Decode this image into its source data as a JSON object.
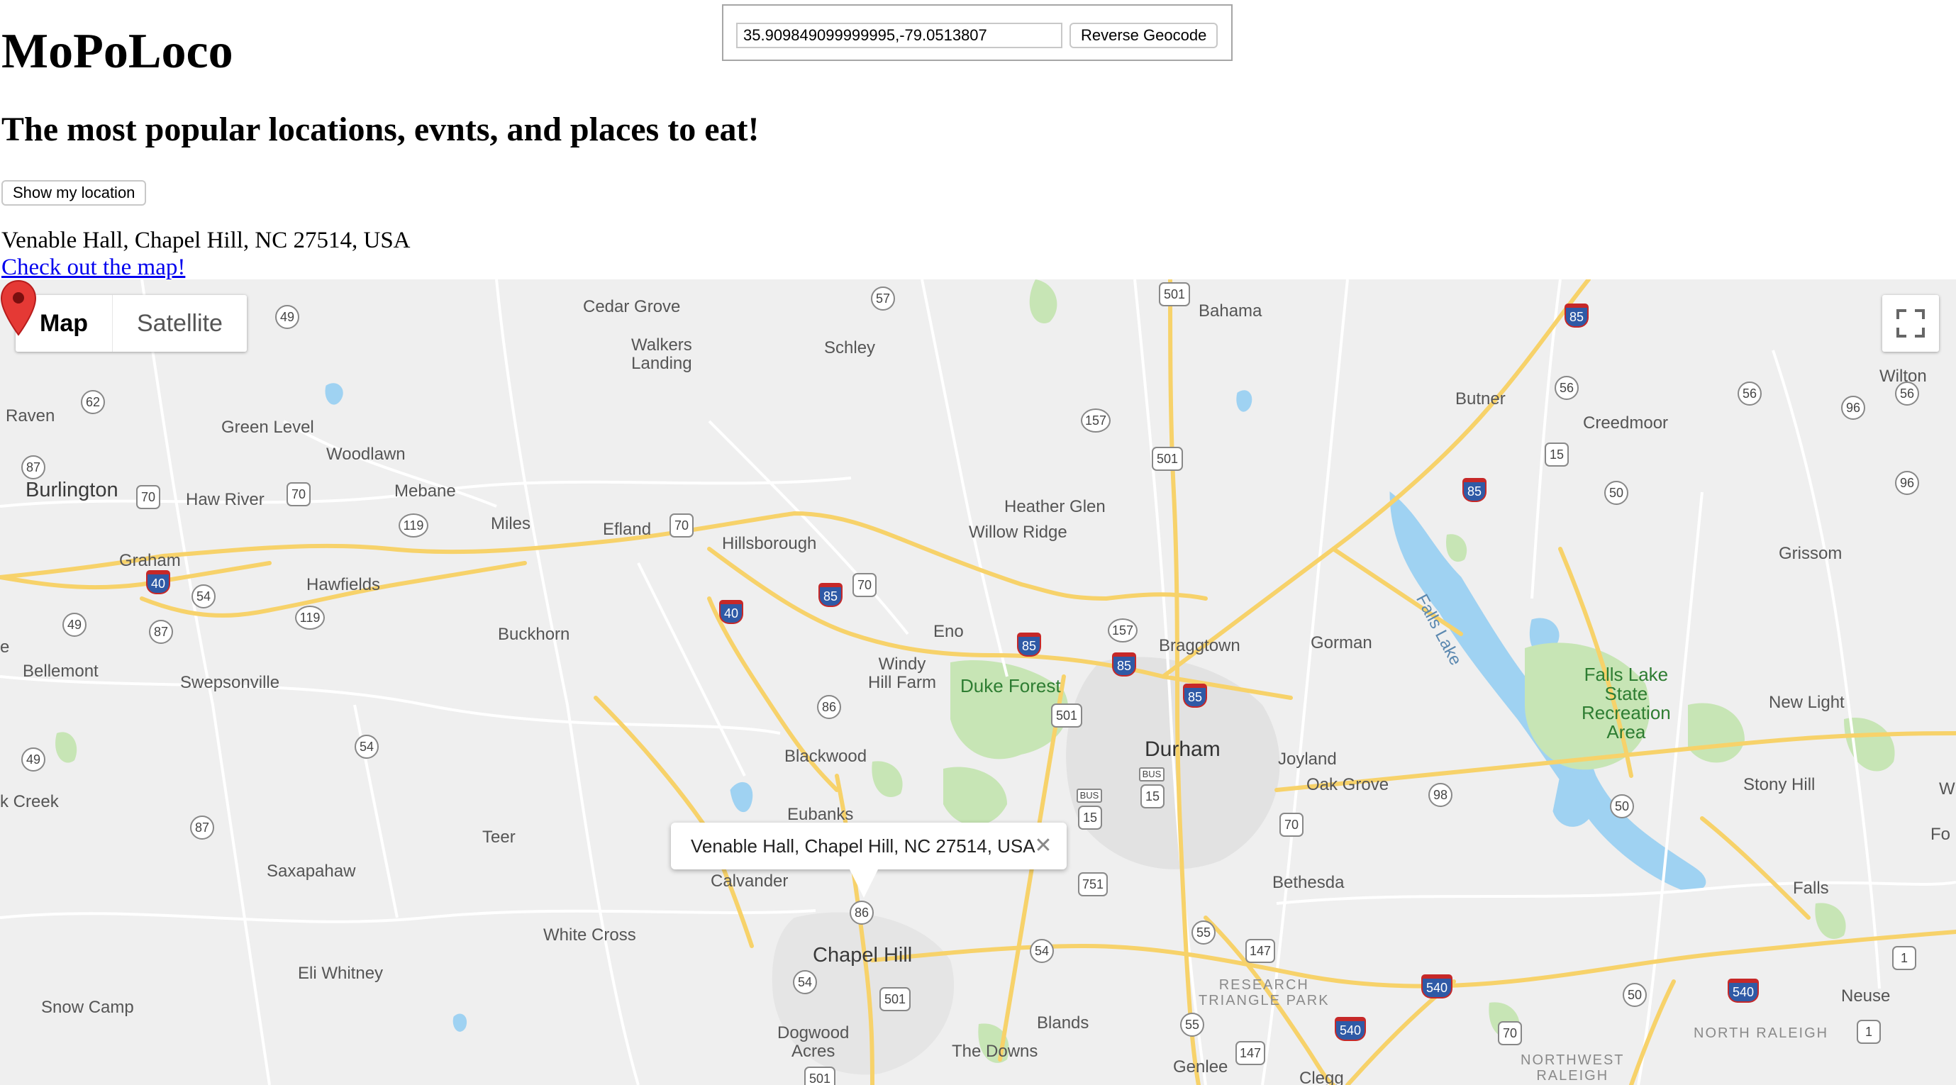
{
  "app": {
    "title": "MoPoLoco",
    "tagline": "The most popular locations, evnts, and places to eat!",
    "show_location_label": "Show my location",
    "address": "Venable Hall, Chapel Hill, NC 27514, USA",
    "map_link_label": "Check out the map!"
  },
  "geocoder": {
    "latlng_value": "35.909849099999995,-79.0513807",
    "button_label": "Reverse Geocode"
  },
  "map": {
    "type_controls": {
      "active": "Map",
      "inactive": "Satellite"
    },
    "fullscreen_icon": "fullscreen-icon",
    "marker_icon": "map-pin-icon",
    "info_window": {
      "text": "Venable Hall, Chapel Hill, NC 27514, USA",
      "close_icon": "close-icon"
    },
    "labels": {
      "cedar_grove": "Cedar Grove",
      "bahama": "Bahama",
      "walkers_landing": "Walkers\nLanding",
      "schley": "Schley",
      "wilton": "Wilton",
      "raven": "Raven",
      "green_level": "Green Level",
      "butner": "Butner",
      "creedmoor": "Creedmoor",
      "woodlawn": "Woodlawn",
      "burlington": "Burlington",
      "haw_river": "Haw River",
      "mebane": "Mebane",
      "heather_glen": "Heather Glen",
      "miles": "Miles",
      "efland": "Efland",
      "willow_ridge": "Willow Ridge",
      "hillsborough": "Hillsborough",
      "graham": "Graham",
      "grissom": "Grissom",
      "hawfields": "Hawfields",
      "falls_lake": "Falls Lake",
      "eno": "Eno",
      "buckhorn": "Buckhorn",
      "bellemont": "Bellemont",
      "windy_hill_farm": "Windy\nHill Farm",
      "braggtown": "Braggtown",
      "gorman": "Gorman",
      "falls_lake_sra": "Falls Lake\nState\nRecreation\nArea",
      "swepsonville": "Swepsonville",
      "duke_forest": "Duke Forest",
      "new_light": "New Light",
      "durham": "Durham",
      "blackwood": "Blackwood",
      "joyland": "Joyland",
      "oak_grove": "Oak Grove",
      "stony_hill": "Stony Hill",
      "k_creek": "k Creek",
      "eubanks": "Eubanks",
      "teer": "Teer",
      "saxapahaw": "Saxapahaw",
      "calvander": "Calvander",
      "bethesda": "Bethesda",
      "falls": "Falls",
      "white_cross": "White Cross",
      "chapel_hill": "Chapel Hill",
      "eli_whitney": "Eli Whitney",
      "snow_camp": "Snow Camp",
      "research_triangle_park": "RESEARCH\nTRIANGLE PARK",
      "neuse": "Neuse",
      "dogwood_acres": "Dogwood\nAcres",
      "blands": "Blands",
      "north_raleigh": "NORTH RALEIGH",
      "the_downs": "The Downs",
      "genlee": "Genlee",
      "clegg": "Clegg",
      "northwest_raleigh": "NORTHWEST\nRALEIGH",
      "edge_w": "W",
      "edge_fo": "Fo",
      "edge_e": "e"
    },
    "shields": {
      "s57": "57",
      "s501a": "501",
      "s85a": "85",
      "s49a": "49",
      "s56a": "56",
      "s56b": "56",
      "s62": "62",
      "s96a": "96",
      "s157a": "157",
      "s501b": "501",
      "s15a": "15",
      "s87a": "87",
      "s70a": "70",
      "s70b": "70",
      "s96b": "96",
      "s85b": "85",
      "s50a": "50",
      "s119a": "119",
      "s70c": "70",
      "s40a": "40",
      "s54a": "54",
      "s85c": "85",
      "s70d": "70",
      "s119b": "119",
      "s40b": "40",
      "s49b": "49",
      "s87b": "87",
      "s157b": "157",
      "s85d": "85",
      "s85e": "85",
      "s85f": "85",
      "s501c": "501",
      "s86": "86",
      "s54b": "54",
      "s49c": "49",
      "s15b": "15",
      "s15c": "15",
      "s98": "98",
      "s87c": "87",
      "s70e": "70",
      "s50b": "50",
      "s751": "751",
      "s86b": "86",
      "s55a": "55",
      "s147a": "147",
      "s54c": "54",
      "s1a": "1",
      "s540a": "540",
      "s54d": "54",
      "s501d": "501",
      "s50c": "50",
      "s540b": "540",
      "s55b": "55",
      "s540c": "540",
      "s70f": "70",
      "s147b": "147",
      "s1b": "1",
      "s501e": "501",
      "s_bus_a": "BUS",
      "s_bus_b": "BUS"
    }
  }
}
